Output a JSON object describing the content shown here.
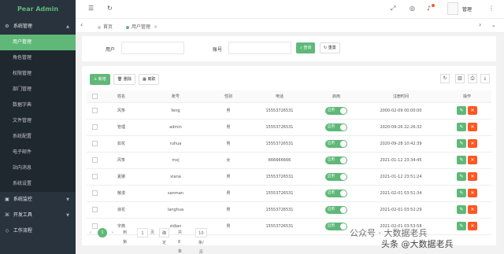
{
  "brand": {
    "title": "Pear Admin"
  },
  "sidebar": {
    "groups": [
      {
        "label": "系统管理",
        "expanded": true
      },
      {
        "label": "系统监控"
      },
      {
        "label": "开发工具"
      },
      {
        "label": "工作流程"
      }
    ],
    "items": [
      {
        "label": "用户管理",
        "active": true
      },
      {
        "label": "角色管理"
      },
      {
        "label": "权限管理"
      },
      {
        "label": "部门管理"
      },
      {
        "label": "数据字典"
      },
      {
        "label": "文件管理"
      },
      {
        "label": "系统配置"
      },
      {
        "label": "电子邮件"
      },
      {
        "label": "站内消息"
      },
      {
        "label": "系统设置"
      }
    ]
  },
  "header": {
    "menu_icon": "menu-fold-icon",
    "refresh_icon": "refresh-icon",
    "username": "管理"
  },
  "tabs": {
    "home": "首页",
    "current": "用户管理",
    "close": "×"
  },
  "search": {
    "user_label": "用户",
    "account_label": "账号",
    "query_button": "查询",
    "reset_button": "重置"
  },
  "toolbar": {
    "add_button": "新增",
    "delete_button": "删除",
    "batch_button": "离职"
  },
  "table": {
    "columns": [
      "姓名",
      "账号",
      "性别",
      "电话",
      "启用",
      "注册时间",
      "操作"
    ],
    "rows": [
      {
        "name": "风筝",
        "account": "feng",
        "gender": "男",
        "phone": "15553726531",
        "enabled": "启用",
        "registered": "2000-02-09 00:00:00"
      },
      {
        "name": "管理",
        "account": "admin",
        "gender": "男",
        "phone": "15553726531",
        "enabled": "启用",
        "registered": "2020-09-26 22:26:32"
      },
      {
        "name": "如花",
        "account": "ruhua",
        "gender": "男",
        "phone": "15553726531",
        "enabled": "启用",
        "registered": "2020-09-28 10:42:39"
      },
      {
        "name": "风筝",
        "account": "mxj",
        "gender": "女",
        "phone": "666666666",
        "enabled": "启用",
        "registered": "2021-01-12 23:34:45"
      },
      {
        "name": "夏娜",
        "account": "xiana",
        "gender": "男",
        "phone": "15553726531",
        "enabled": "启用",
        "registered": "2021-01-12 23:51:24"
      },
      {
        "name": "散漫",
        "account": "sanman",
        "gender": "男",
        "phone": "15553726531",
        "enabled": "启用",
        "registered": "2021-02-01 03:51:34"
      },
      {
        "name": "浪花",
        "account": "langhua",
        "gender": "男",
        "phone": "15553726531",
        "enabled": "启用",
        "registered": "2021-02-01 03:52:29"
      },
      {
        "name": "字典",
        "account": "zidian",
        "gender": "男",
        "phone": "15553726531",
        "enabled": "启用",
        "registered": "2021-02-01 03:53:58"
      }
    ]
  },
  "pagination": {
    "prev": "‹",
    "current": "1",
    "next": "›",
    "goto_label": "到第",
    "goto_value": "1",
    "page_unit": "页",
    "confirm": "确定",
    "total": "共 8 条",
    "page_size": "10 条/页"
  },
  "watermark": {
    "line1": "公众号 · 大数据老兵",
    "line2": "头条 @大数据老兵"
  },
  "colors": {
    "accent": "#5fb878",
    "danger": "#ff5722",
    "sidebar": "#28333e"
  }
}
